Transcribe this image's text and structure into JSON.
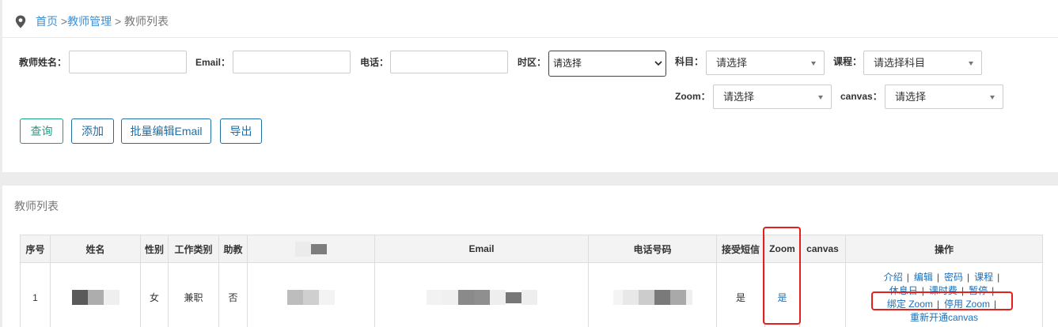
{
  "breadcrumb": {
    "icon": "location-pin-icon",
    "home": "首页",
    "separator_1": " >",
    "section": "教师管理",
    "separator_2": " > ",
    "current": "教师列表"
  },
  "filters": {
    "teacher_name": {
      "label": "教师姓名：",
      "value": ""
    },
    "email": {
      "label": "Email：",
      "value": ""
    },
    "phone": {
      "label": "电话：",
      "value": ""
    },
    "timezone": {
      "label": "时区：",
      "selected": "请选择",
      "icon": "chevron-down-icon"
    },
    "subject": {
      "label": "科目：",
      "selected": "请选择",
      "icon": "dropdown-arrow-icon"
    },
    "course": {
      "label": "课程：",
      "selected": "请选择科目",
      "icon": "dropdown-arrow-icon"
    },
    "zoom": {
      "label": "Zoom：",
      "selected": "请选择",
      "icon": "dropdown-arrow-icon"
    },
    "canvas": {
      "label": "canvas：",
      "selected": "请选择",
      "icon": "dropdown-arrow-icon"
    }
  },
  "toolbar": {
    "query": "查询",
    "add": "添加",
    "bulk_edit_email": "批量编辑Email",
    "export": "导出"
  },
  "teacher_list": {
    "title": "教师列表",
    "columns": {
      "index": "序号",
      "name": "姓名",
      "gender": "性别",
      "work_type": "工作类别",
      "assistant": "助教",
      "email": "Email",
      "phone": "电话号码",
      "accept_sms": "接受短信",
      "zoom": "Zoom",
      "canvas": "canvas",
      "actions": "操作"
    },
    "action_separator": "|",
    "rows": [
      {
        "index": "1",
        "gender": "女",
        "work_type": "兼职",
        "assistant": "否",
        "accept_sms": "是",
        "zoom": "是",
        "actions": [
          "介绍",
          "编辑",
          "密码",
          "课程",
          "休息日",
          "课时费",
          "暂停",
          "绑定 Zoom",
          "停用 Zoom",
          "重新开通canvas"
        ]
      }
    ]
  },
  "colors": {
    "breadcrumb_link": "#3d8fd3",
    "table_link": "#1a6fba",
    "query_button": "#1aa087",
    "secondary_button": "#1f6fa3",
    "annotation_box": "#e3211c"
  }
}
